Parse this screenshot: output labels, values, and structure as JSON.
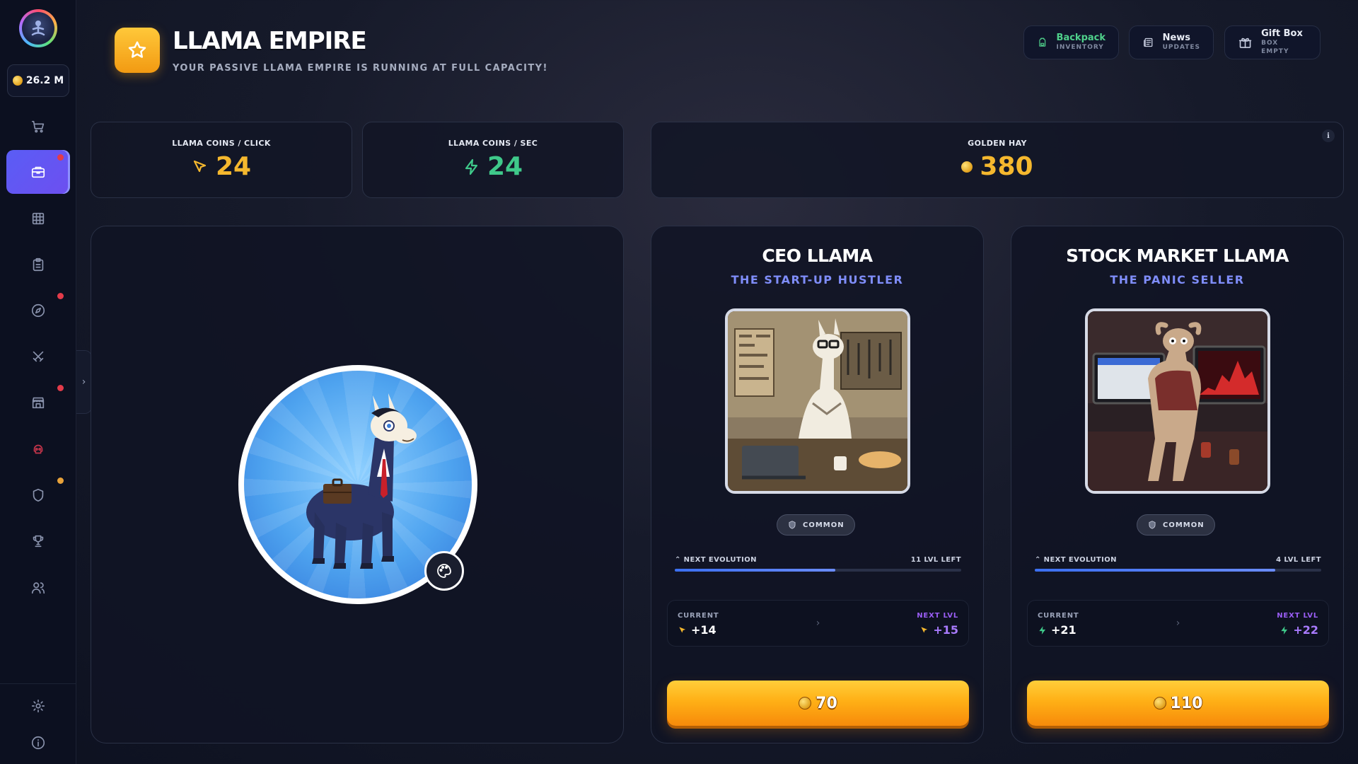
{
  "app": {
    "title": "LLAMA EMPIRE",
    "subtitle": "YOUR PASSIVE LLAMA EMPIRE IS RUNNING AT FULL CAPACITY!"
  },
  "sidebar": {
    "balance": "26.2 M",
    "items": [
      {
        "name": "shop",
        "icon": "cart-icon",
        "active": false,
        "dot": null
      },
      {
        "name": "empire",
        "icon": "briefcase-icon",
        "active": true,
        "dot": "#e33b4a"
      },
      {
        "name": "grid",
        "icon": "grid-icon",
        "active": false,
        "dot": null
      },
      {
        "name": "tasks",
        "icon": "clipboard-icon",
        "active": false,
        "dot": null
      },
      {
        "name": "explore",
        "icon": "compass-icon",
        "active": false,
        "dot": "#e33b4a"
      },
      {
        "name": "battle",
        "icon": "crossed-swords-icon",
        "active": false,
        "dot": null
      },
      {
        "name": "store",
        "icon": "storefront-icon",
        "active": false,
        "dot": "#e33b4a"
      },
      {
        "name": "skull",
        "icon": "skull-icon",
        "active": false,
        "dot": null
      },
      {
        "name": "defense",
        "icon": "shield-icon",
        "active": false,
        "dot": "#e8a23a"
      },
      {
        "name": "trophies",
        "icon": "trophy-icon",
        "active": false,
        "dot": null
      },
      {
        "name": "friends",
        "icon": "users-icon",
        "active": false,
        "dot": null
      }
    ],
    "bottom": [
      {
        "name": "settings",
        "icon": "gear-icon"
      },
      {
        "name": "info",
        "icon": "info-icon"
      }
    ]
  },
  "header_buttons": [
    {
      "label": "Backpack",
      "sub": "INVENTORY",
      "icon": "backpack-icon",
      "accent": "#4fd18b"
    },
    {
      "label": "News",
      "sub": "UPDATES",
      "icon": "newspaper-icon",
      "accent": null
    },
    {
      "label": "Gift Box",
      "sub": "BOX EMPTY",
      "icon": "gift-icon",
      "accent": null
    }
  ],
  "stats": {
    "per_click": {
      "label": "LLAMA COINS / CLICK",
      "value": "24",
      "color": "#f5b82e",
      "icon": "cursor-icon"
    },
    "per_sec": {
      "label": "LLAMA COINS / SEC",
      "value": "24",
      "color": "#3fc98a",
      "icon": "lightning-icon"
    },
    "golden_hay": {
      "label": "GOLDEN HAY",
      "value": "380",
      "color": "#f5b82e",
      "icon": "golden-hay-icon",
      "info": "i"
    }
  },
  "cards": [
    {
      "title": "CEO LLAMA",
      "tagline": "THE START-UP HUSTLER",
      "rarity": "COMMON",
      "evolution_label": "NEXT EVOLUTION",
      "levels_left": "11 LVL LEFT",
      "evolution_progress": 0.56,
      "current_label": "CURRENT",
      "current_value": "+14",
      "next_label": "NEXT LVL",
      "next_value": "+15",
      "stat_icon": "cursor-icon",
      "price": "70"
    },
    {
      "title": "STOCK MARKET LLAMA",
      "tagline": "THE PANIC SELLER",
      "rarity": "COMMON",
      "evolution_label": "NEXT EVOLUTION",
      "levels_left": "4 LVL LEFT",
      "evolution_progress": 0.84,
      "current_label": "CURRENT",
      "current_value": "+21",
      "next_label": "NEXT LVL",
      "next_value": "+22",
      "stat_icon": "lightning-icon",
      "price": "110"
    }
  ]
}
